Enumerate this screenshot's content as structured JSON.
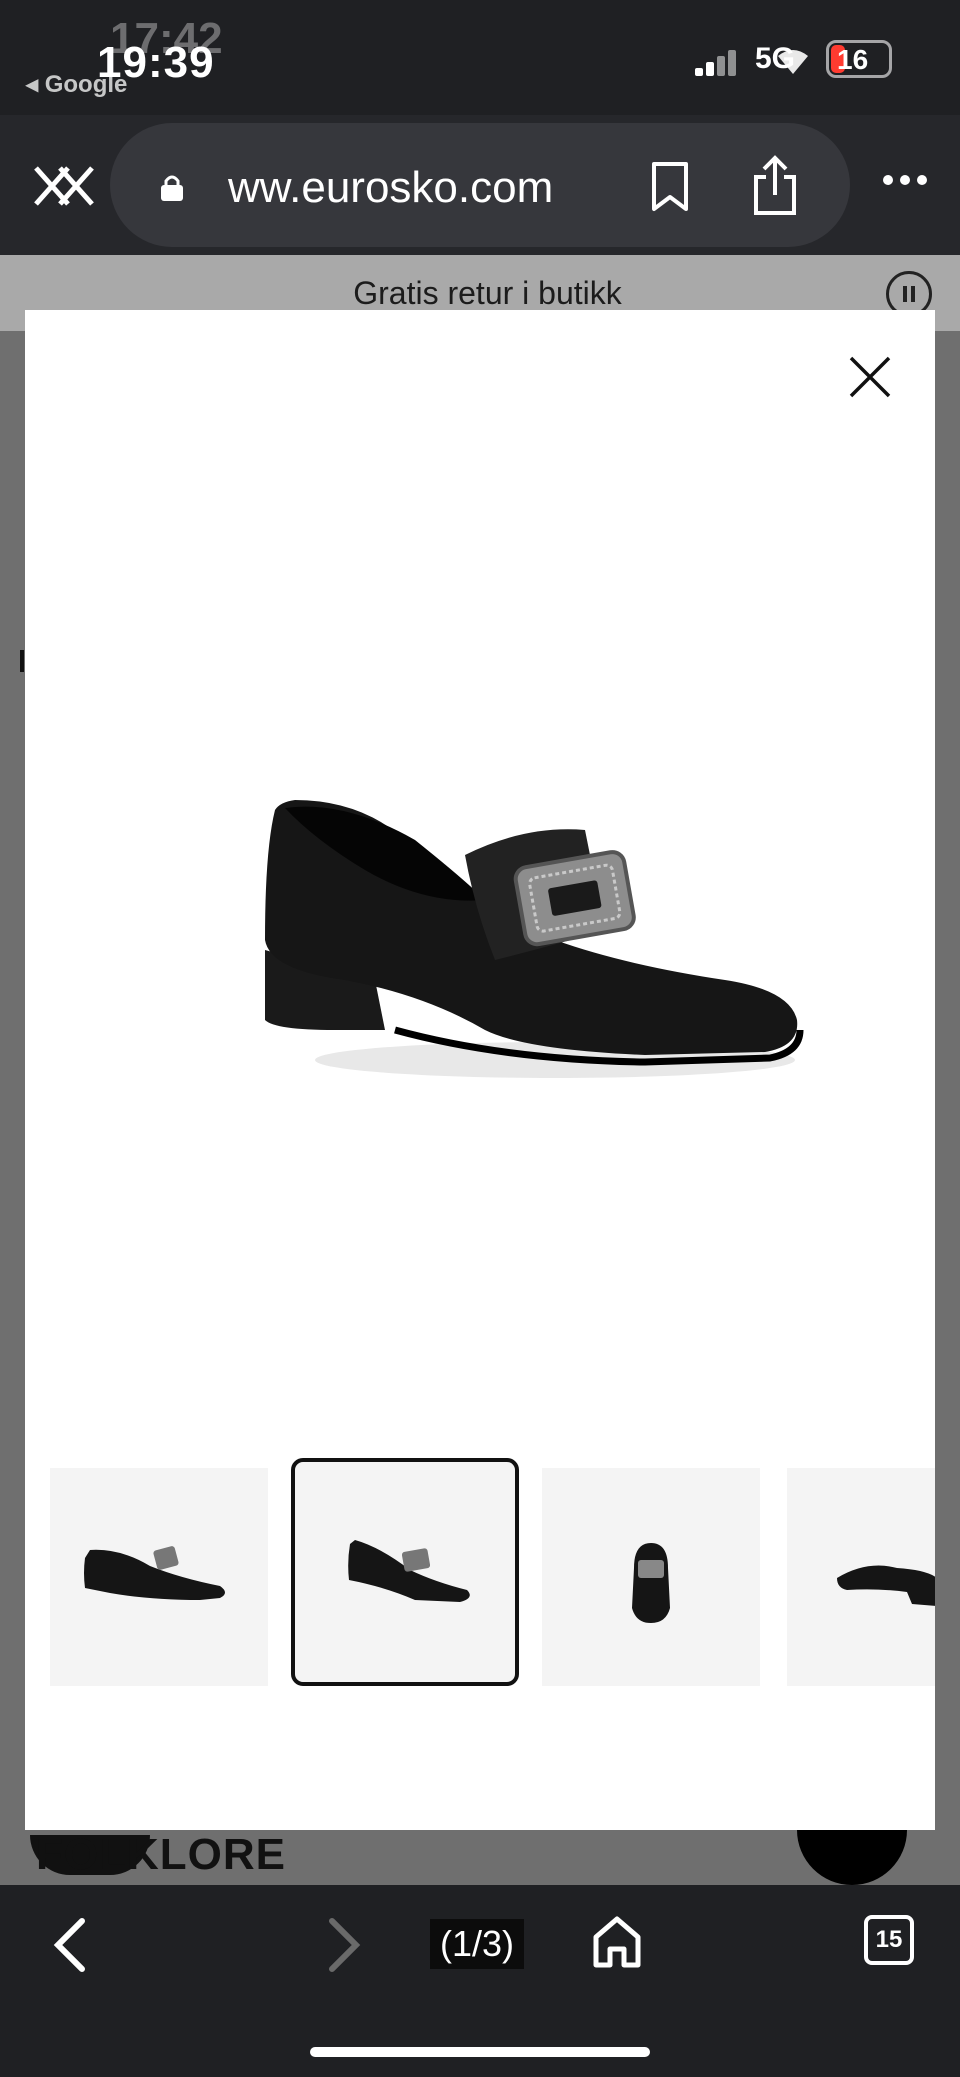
{
  "status_bar": {
    "time_ghost": "17:42",
    "time": "19:39",
    "back_app": "◂ Google",
    "network": "5G",
    "battery_level": "16"
  },
  "browser": {
    "url": "ww.eurosko.com",
    "icons": [
      "close-tabs-icon",
      "lock-icon",
      "bookmark-icon",
      "share-icon",
      "more-icon"
    ]
  },
  "site": {
    "promo_text": "Gratis retur i butikk",
    "brand_partial": "FOLKLORE"
  },
  "gallery": {
    "selected_index": 2,
    "thumbnails": [
      "side-view",
      "three-quarter-view",
      "front-view",
      "partial-side-view"
    ]
  },
  "toolbar": {
    "image_counter": "(1/3)",
    "tabs_count": "15"
  },
  "colors": {
    "chrome_dark": "#1f2023",
    "url_pill": "#36373c",
    "overlay_gray": "#6f6f6f",
    "promo_gray": "#a9a9a9"
  }
}
